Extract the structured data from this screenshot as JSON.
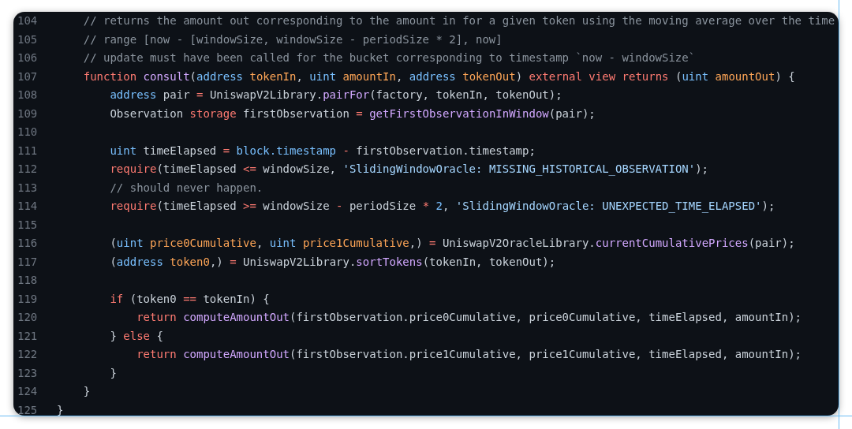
{
  "editor": {
    "lines": [
      {
        "number": "104",
        "tokens": [
          {
            "kind": "comment",
            "text": "    // returns the amount out corresponding to the amount in for a given token using the moving average over the time"
          }
        ]
      },
      {
        "number": "105",
        "tokens": [
          {
            "kind": "comment",
            "text": "    // range [now - [windowSize, windowSize - periodSize * 2], now]"
          }
        ]
      },
      {
        "number": "106",
        "tokens": [
          {
            "kind": "comment",
            "text": "    // update must have been called for the bucket corresponding to timestamp `now - windowSize`"
          }
        ]
      },
      {
        "number": "107",
        "tokens": [
          {
            "kind": "keyword",
            "text": "    function"
          },
          {
            "kind": "function",
            "text": " consult"
          },
          {
            "kind": "plain",
            "text": "("
          },
          {
            "kind": "type",
            "text": "address"
          },
          {
            "kind": "param",
            "text": " tokenIn"
          },
          {
            "kind": "plain",
            "text": ", "
          },
          {
            "kind": "type",
            "text": "uint"
          },
          {
            "kind": "param",
            "text": " amountIn"
          },
          {
            "kind": "plain",
            "text": ", "
          },
          {
            "kind": "type",
            "text": "address"
          },
          {
            "kind": "param",
            "text": " tokenOut"
          },
          {
            "kind": "plain",
            "text": ") "
          },
          {
            "kind": "keyword",
            "text": "external view returns"
          },
          {
            "kind": "plain",
            "text": " ("
          },
          {
            "kind": "type",
            "text": "uint"
          },
          {
            "kind": "param",
            "text": " amountOut"
          },
          {
            "kind": "plain",
            "text": ") {"
          }
        ]
      },
      {
        "number": "108",
        "tokens": [
          {
            "kind": "type",
            "text": "        address"
          },
          {
            "kind": "plain",
            "text": " pair "
          },
          {
            "kind": "operator",
            "text": "="
          },
          {
            "kind": "plain",
            "text": " UniswapV2Library."
          },
          {
            "kind": "function",
            "text": "pairFor"
          },
          {
            "kind": "plain",
            "text": "(factory, tokenIn, tokenOut);"
          }
        ]
      },
      {
        "number": "109",
        "tokens": [
          {
            "kind": "plain",
            "text": "        Observation "
          },
          {
            "kind": "keyword",
            "text": "storage"
          },
          {
            "kind": "plain",
            "text": " firstObservation "
          },
          {
            "kind": "operator",
            "text": "="
          },
          {
            "kind": "function",
            "text": " getFirstObservationInWindow"
          },
          {
            "kind": "plain",
            "text": "(pair);"
          }
        ]
      },
      {
        "number": "110"
      },
      {
        "number": "111",
        "tokens": [
          {
            "kind": "type",
            "text": "        uint"
          },
          {
            "kind": "plain",
            "text": " timeElapsed "
          },
          {
            "kind": "operator",
            "text": "="
          },
          {
            "kind": "type",
            "text": " block.timestamp"
          },
          {
            "kind": "operator",
            "text": " -"
          },
          {
            "kind": "plain",
            "text": " firstObservation.timestamp;"
          }
        ]
      },
      {
        "number": "112",
        "tokens": [
          {
            "kind": "keyword",
            "text": "        require"
          },
          {
            "kind": "plain",
            "text": "(timeElapsed "
          },
          {
            "kind": "operator",
            "text": "<="
          },
          {
            "kind": "plain",
            "text": " windowSize, "
          },
          {
            "kind": "string",
            "text": "'SlidingWindowOracle: MISSING_HISTORICAL_OBSERVATION'"
          },
          {
            "kind": "plain",
            "text": ");"
          }
        ]
      },
      {
        "number": "113",
        "tokens": [
          {
            "kind": "comment",
            "text": "        // should never happen."
          }
        ]
      },
      {
        "number": "114",
        "tokens": [
          {
            "kind": "keyword",
            "text": "        require"
          },
          {
            "kind": "plain",
            "text": "(timeElapsed "
          },
          {
            "kind": "operator",
            "text": ">="
          },
          {
            "kind": "plain",
            "text": " windowSize "
          },
          {
            "kind": "operator",
            "text": "-"
          },
          {
            "kind": "plain",
            "text": " periodSize "
          },
          {
            "kind": "operator",
            "text": "*"
          },
          {
            "kind": "number",
            "text": " 2"
          },
          {
            "kind": "plain",
            "text": ", "
          },
          {
            "kind": "string",
            "text": "'SlidingWindowOracle: UNEXPECTED_TIME_ELAPSED'"
          },
          {
            "kind": "plain",
            "text": ");"
          }
        ]
      },
      {
        "number": "115"
      },
      {
        "number": "116",
        "tokens": [
          {
            "kind": "plain",
            "text": "        ("
          },
          {
            "kind": "type",
            "text": "uint"
          },
          {
            "kind": "param",
            "text": " price0Cumulative"
          },
          {
            "kind": "plain",
            "text": ", "
          },
          {
            "kind": "type",
            "text": "uint"
          },
          {
            "kind": "param",
            "text": " price1Cumulative"
          },
          {
            "kind": "plain",
            "text": ",) "
          },
          {
            "kind": "operator",
            "text": "="
          },
          {
            "kind": "plain",
            "text": " UniswapV2OracleLibrary."
          },
          {
            "kind": "function",
            "text": "currentCumulativePrices"
          },
          {
            "kind": "plain",
            "text": "(pair);"
          }
        ]
      },
      {
        "number": "117",
        "tokens": [
          {
            "kind": "plain",
            "text": "        ("
          },
          {
            "kind": "type",
            "text": "address"
          },
          {
            "kind": "param",
            "text": " token0"
          },
          {
            "kind": "plain",
            "text": ",) "
          },
          {
            "kind": "operator",
            "text": "="
          },
          {
            "kind": "plain",
            "text": " UniswapV2Library."
          },
          {
            "kind": "function",
            "text": "sortTokens"
          },
          {
            "kind": "plain",
            "text": "(tokenIn, tokenOut);"
          }
        ]
      },
      {
        "number": "118"
      },
      {
        "number": "119",
        "tokens": [
          {
            "kind": "keyword",
            "text": "        if"
          },
          {
            "kind": "plain",
            "text": " (token0 "
          },
          {
            "kind": "operator",
            "text": "=="
          },
          {
            "kind": "plain",
            "text": " tokenIn) {"
          }
        ]
      },
      {
        "number": "120",
        "tokens": [
          {
            "kind": "keyword",
            "text": "            return"
          },
          {
            "kind": "function",
            "text": " computeAmountOut"
          },
          {
            "kind": "plain",
            "text": "(firstObservation.price0Cumulative, price0Cumulative, timeElapsed, amountIn);"
          }
        ]
      },
      {
        "number": "121",
        "tokens": [
          {
            "kind": "plain",
            "text": "        } "
          },
          {
            "kind": "keyword",
            "text": "else"
          },
          {
            "kind": "plain",
            "text": " {"
          }
        ]
      },
      {
        "number": "122",
        "tokens": [
          {
            "kind": "keyword",
            "text": "            return"
          },
          {
            "kind": "function",
            "text": " computeAmountOut"
          },
          {
            "kind": "plain",
            "text": "(firstObservation.price1Cumulative, price1Cumulative, timeElapsed, amountIn);"
          }
        ]
      },
      {
        "number": "123",
        "tokens": [
          {
            "kind": "plain",
            "text": "        }"
          }
        ]
      },
      {
        "number": "124",
        "tokens": [
          {
            "kind": "plain",
            "text": "    }"
          }
        ]
      },
      {
        "number": "125",
        "tokens": [
          {
            "kind": "plain",
            "text": "}"
          }
        ]
      }
    ]
  }
}
